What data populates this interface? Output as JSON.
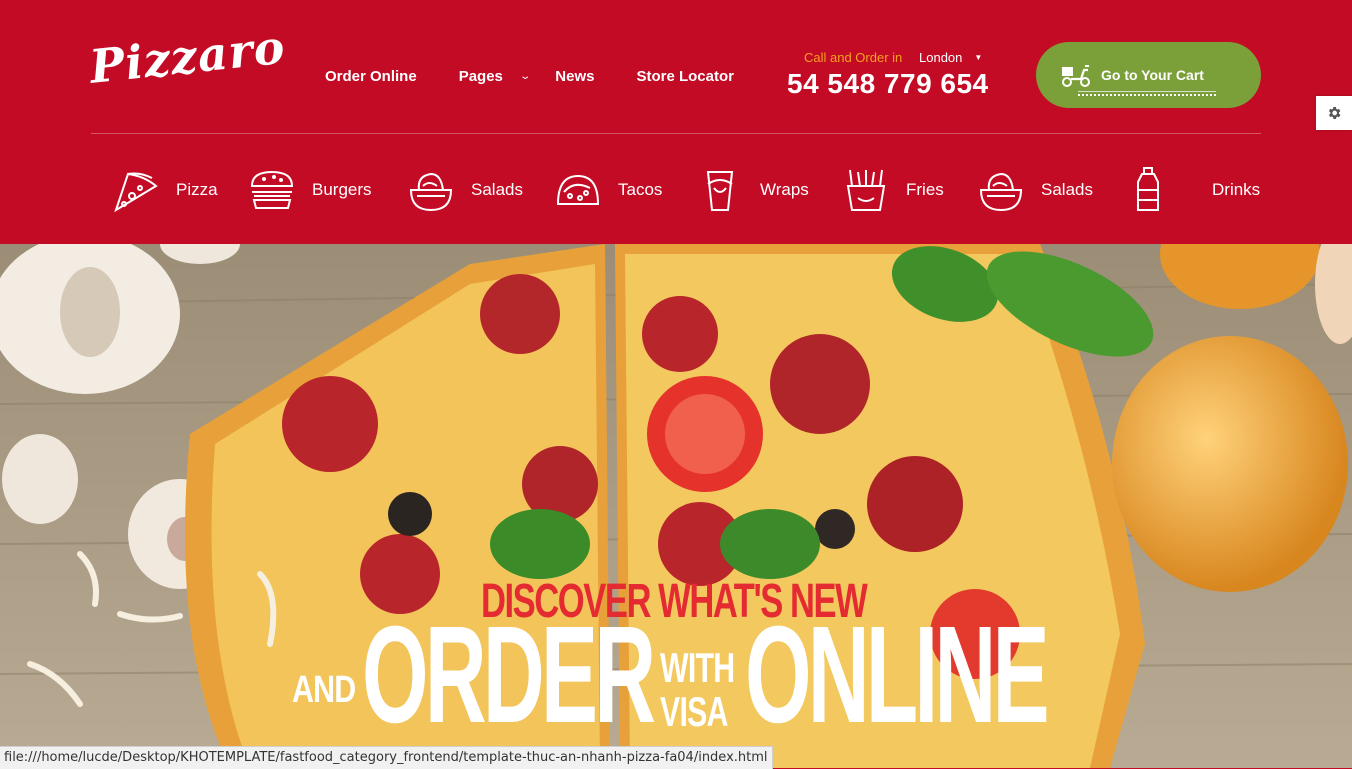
{
  "logo": {
    "text": "Pizzaro"
  },
  "nav": {
    "items": [
      {
        "label": "Order Online"
      },
      {
        "label": "Pages",
        "has_dropdown": true
      },
      {
        "label": "News"
      },
      {
        "label": "Store Locator"
      }
    ]
  },
  "contact": {
    "call_label": "Call and Order in",
    "city": "London",
    "phone": "54 548 779 654"
  },
  "cart": {
    "label": "Go to Your Cart",
    "icon": "scooter-icon"
  },
  "categories": [
    {
      "label": "Pizza",
      "icon": "pizza-icon"
    },
    {
      "label": "Burgers",
      "icon": "burger-icon"
    },
    {
      "label": "Salads",
      "icon": "salad-icon"
    },
    {
      "label": "Tacos",
      "icon": "taco-icon"
    },
    {
      "label": "Wraps",
      "icon": "wrap-icon"
    },
    {
      "label": "Fries",
      "icon": "fries-icon"
    },
    {
      "label": "Salads",
      "icon": "salad-icon"
    },
    {
      "label": "Drinks",
      "icon": "drink-icon"
    }
  ],
  "hero": {
    "subtitle": "DISCOVER WHAT'S NEW",
    "word_and": "AND",
    "word_order": "ORDER",
    "word_with": "WITH",
    "word_visa": "VISA",
    "word_online": "ONLINE"
  },
  "settings": {
    "icon": "gear-icon"
  },
  "status_bar": {
    "url": "file:///home/lucde/Desktop/KHOTEMPLATE/fastfood_category_frontend/template-thuc-an-nhanh-pizza-fa04/index.html"
  },
  "colors": {
    "brand_red": "#c40b25",
    "cart_green": "#7ba03a",
    "call_orange": "#f4a11f",
    "hero_red_text": "#e52b32"
  }
}
